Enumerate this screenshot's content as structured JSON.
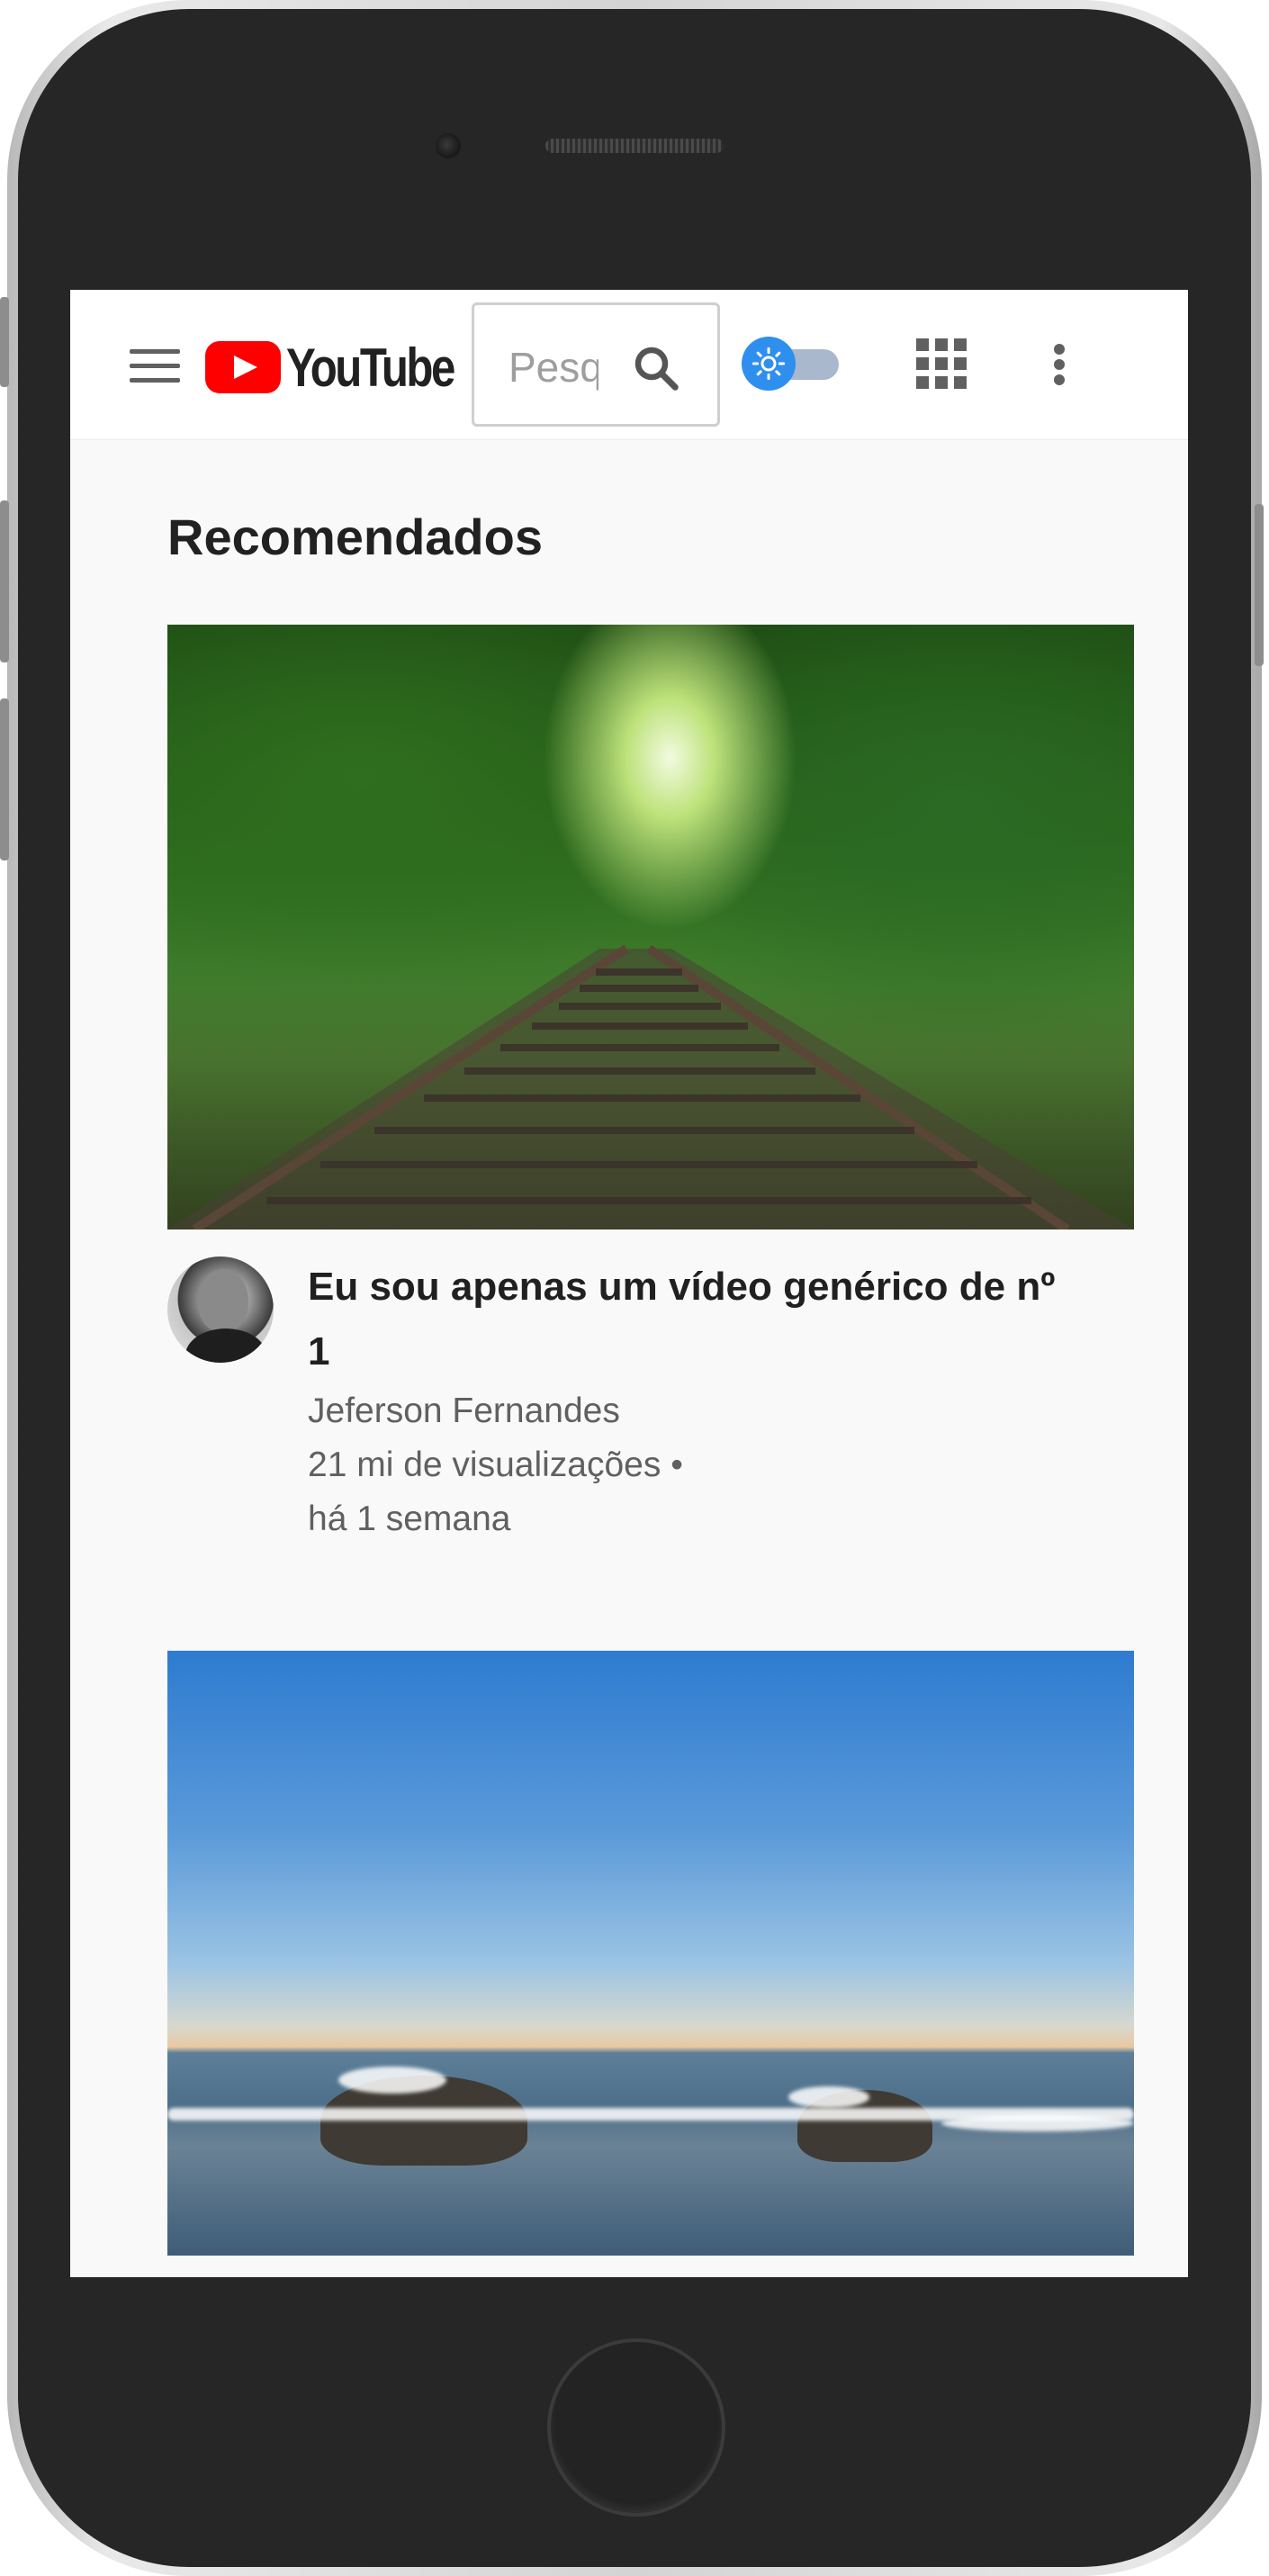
{
  "header": {
    "logo_text": "YouTube",
    "search_placeholder": "Pesquisar",
    "menu_icon": "hamburger-menu-icon",
    "search_icon": "search-icon",
    "theme_toggle_icon": "sun-icon",
    "apps_icon": "grid-apps-icon",
    "more_icon": "more-vertical-icon",
    "brand_color": "#ff0000",
    "toggle_color": "#2f8fef"
  },
  "main": {
    "section_title": "Recomendados",
    "videos": [
      {
        "title": "Eu sou apenas um vídeo genérico de nº 1",
        "channel": "Jeferson Fernandes",
        "views": "21 mi de visualizações •",
        "age": "há 1 semana"
      },
      {
        "title": "",
        "channel": "",
        "views": "",
        "age": ""
      }
    ]
  }
}
